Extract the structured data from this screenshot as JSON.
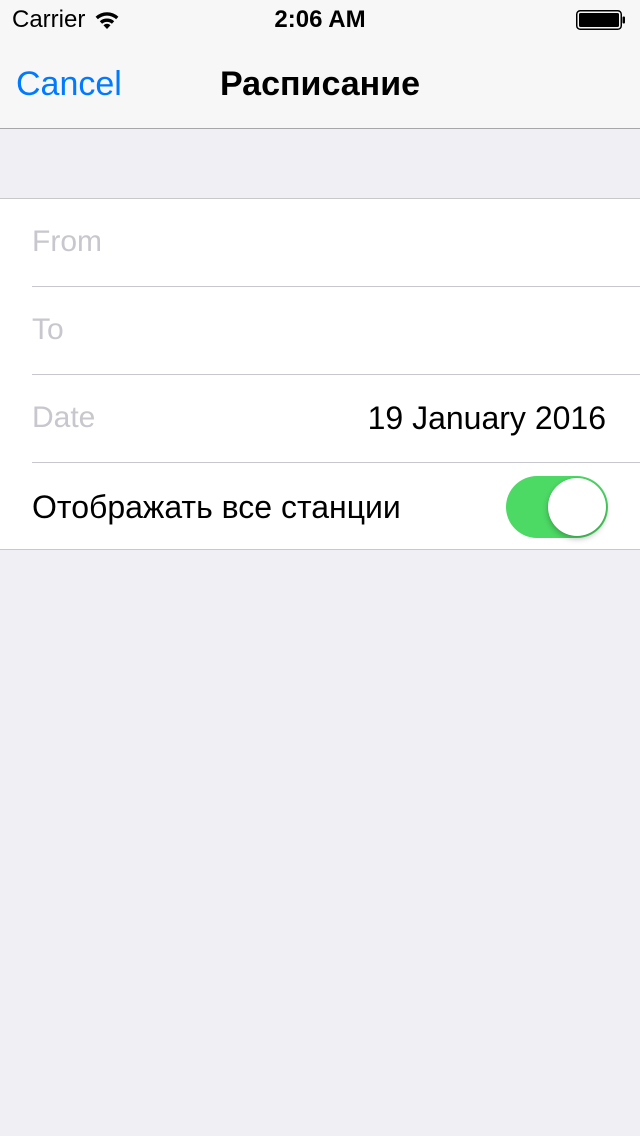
{
  "status_bar": {
    "carrier": "Carrier",
    "time": "2:06 AM",
    "wifi_icon": "wifi-icon",
    "battery_icon": "battery-icon",
    "battery_level": 1.0
  },
  "nav": {
    "cancel_label": "Cancel",
    "title": "Расписание"
  },
  "form": {
    "from": {
      "placeholder": "From",
      "value": ""
    },
    "to": {
      "placeholder": "To",
      "value": ""
    },
    "date": {
      "label": "Date",
      "value": "19 January 2016"
    },
    "show_all_stations": {
      "label": "Отображать все станции",
      "on": true
    }
  },
  "colors": {
    "accent": "#007aff",
    "switch_on": "#4cd964",
    "background": "#efeff4",
    "placeholder": "#c7c7cd"
  }
}
